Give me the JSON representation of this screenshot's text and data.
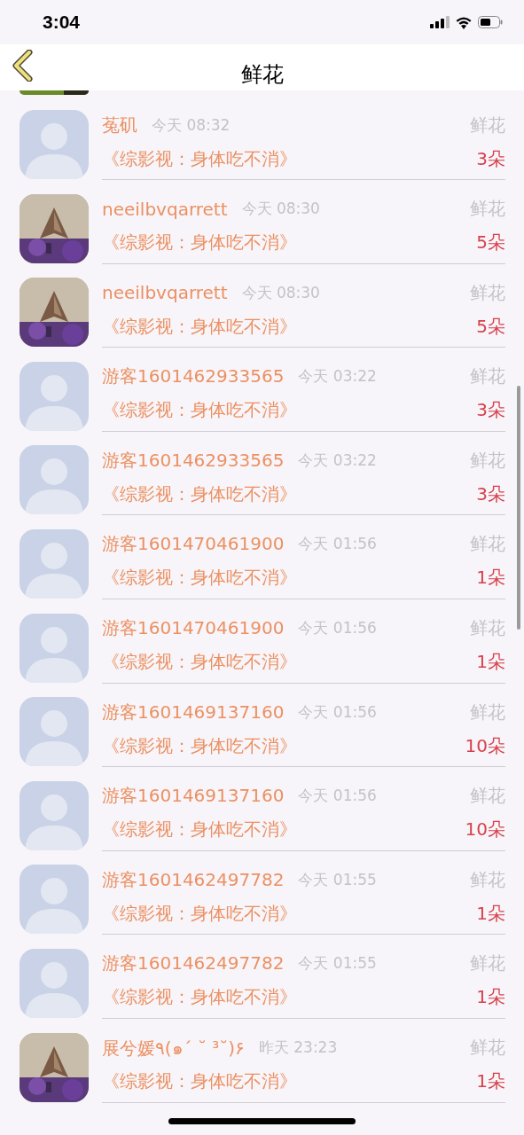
{
  "status_bar": {
    "time": "3:04"
  },
  "nav": {
    "title": "鲜花"
  },
  "top_partial": {
    "photo": true
  },
  "rows": [
    {
      "photo": false,
      "name": "菟矶",
      "time": "今天 08:32",
      "gift": "鲜花",
      "title": "《综影视：身体吃不消》",
      "count": "3朵"
    },
    {
      "photo": true,
      "name": "neeilbvqarrett",
      "time": "今天 08:30",
      "gift": "鲜花",
      "title": "《综影视：身体吃不消》",
      "count": "5朵"
    },
    {
      "photo": true,
      "name": "neeilbvqarrett",
      "time": "今天 08:30",
      "gift": "鲜花",
      "title": "《综影视：身体吃不消》",
      "count": "5朵"
    },
    {
      "photo": false,
      "name": "游客1601462933565",
      "time": "今天 03:22",
      "gift": "鲜花",
      "title": "《综影视：身体吃不消》",
      "count": "3朵"
    },
    {
      "photo": false,
      "name": "游客1601462933565",
      "time": "今天 03:22",
      "gift": "鲜花",
      "title": "《综影视：身体吃不消》",
      "count": "3朵"
    },
    {
      "photo": false,
      "name": "游客1601470461900",
      "time": "今天 01:56",
      "gift": "鲜花",
      "title": "《综影视：身体吃不消》",
      "count": "1朵"
    },
    {
      "photo": false,
      "name": "游客1601470461900",
      "time": "今天 01:56",
      "gift": "鲜花",
      "title": "《综影视：身体吃不消》",
      "count": "1朵"
    },
    {
      "photo": false,
      "name": "游客1601469137160",
      "time": "今天 01:56",
      "gift": "鲜花",
      "title": "《综影视：身体吃不消》",
      "count": "10朵"
    },
    {
      "photo": false,
      "name": "游客1601469137160",
      "time": "今天 01:56",
      "gift": "鲜花",
      "title": "《综影视：身体吃不消》",
      "count": "10朵"
    },
    {
      "photo": false,
      "name": "游客1601462497782",
      "time": "今天 01:55",
      "gift": "鲜花",
      "title": "《综影视：身体吃不消》",
      "count": "1朵"
    },
    {
      "photo": false,
      "name": "游客1601462497782",
      "time": "今天 01:55",
      "gift": "鲜花",
      "title": "《综影视：身体吃不消》",
      "count": "1朵"
    },
    {
      "photo": true,
      "name": "展兮媛٩(๑´ ˘ ³˘)۶",
      "time": "昨天 23:23",
      "gift": "鲜花",
      "title": "《综影视：身体吃不消》",
      "count": "1朵"
    }
  ]
}
